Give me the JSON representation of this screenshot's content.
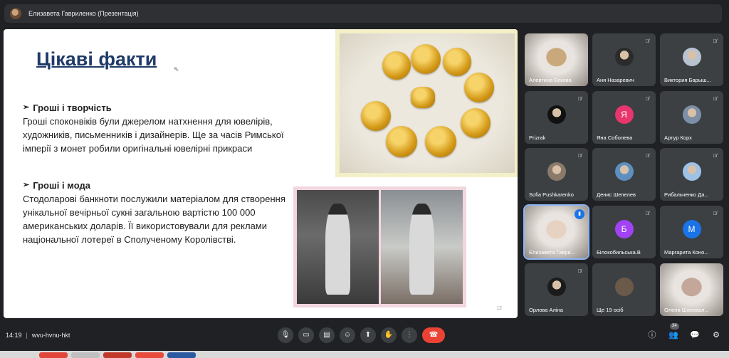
{
  "topbar": {
    "title": "Елизавета Гавриленко (Презентація)"
  },
  "slide": {
    "title": "Цікаві факти",
    "fact1": {
      "heading": "Гроші і творчість",
      "text": "Гроші споконвіків були джерелом натхнення для ювелірів, художників, письменників і дизайнерів. Ще за часів Римської імперії з монет робили оригінальні ювелірні прикраси"
    },
    "fact2": {
      "heading": "Гроші і мода",
      "text": "Стодоларові банкноти послужили матеріалом для створення унікальної вечірньої сукні загальною вартістю 100 000 американських доларів. Її використовували для реклами національної лотереї в Сполученому Королівстві."
    },
    "page_number": "12"
  },
  "participants": [
    {
      "name": "Алевтина Бєкова",
      "type": "video",
      "muted": false,
      "color": "#c9a87c"
    },
    {
      "name": "Аня Назаревич",
      "type": "photo",
      "muted": true,
      "color": "#2b2b2b"
    },
    {
      "name": "Виктория Барыш...",
      "type": "photo",
      "muted": true,
      "color": "#b9c3cf"
    },
    {
      "name": "Prizrak",
      "type": "photo",
      "muted": true,
      "color": "#111111"
    },
    {
      "name": "Яна Соболева",
      "type": "letter",
      "letter": "Я",
      "muted": true,
      "color": "#e8356d"
    },
    {
      "name": "Артур Корх",
      "type": "photo",
      "muted": true,
      "color": "#7c8fa6"
    },
    {
      "name": "Sofia Pushkarenko",
      "type": "photo",
      "muted": true,
      "color": "#8a7a6a"
    },
    {
      "name": "Денис Шепелев",
      "type": "photo",
      "muted": true,
      "color": "#5d8fc0"
    },
    {
      "name": "Рибальченко Да...",
      "type": "photo",
      "muted": true,
      "color": "#9ec2e6"
    },
    {
      "name": "Елизавета Гаври...",
      "type": "video",
      "muted": false,
      "speaking": true,
      "color": "#e7d2c2"
    },
    {
      "name": "Білокобильська.В",
      "type": "letter",
      "letter": "Б",
      "muted": true,
      "color": "#a142f4"
    },
    {
      "name": "Маргарита Коно...",
      "type": "letter",
      "letter": "М",
      "muted": true,
      "color": "#1a73e8"
    },
    {
      "name": "Орлова Аліна",
      "type": "photo",
      "muted": true,
      "color": "#1b1b1b"
    },
    {
      "name": "Ще 19 осіб",
      "type": "more",
      "muted": false,
      "color": "#6b5a4a"
    },
    {
      "name": "Олена Шаповал...",
      "type": "video",
      "muted": false,
      "color": "#c5a79a"
    }
  ],
  "bottombar": {
    "time": "14:19",
    "meeting_code": "wvu-hvnu-hkt",
    "people_count": "34"
  },
  "icons": {
    "mic": "mic-icon",
    "camera": "camera-icon",
    "captions": "captions-icon",
    "emoji": "emoji-icon",
    "present": "present-icon",
    "hand": "hand-icon",
    "more": "more-options-icon",
    "end": "end-call-icon",
    "info": "info-icon",
    "people": "people-icon",
    "chat": "chat-icon",
    "activities": "activities-icon"
  }
}
